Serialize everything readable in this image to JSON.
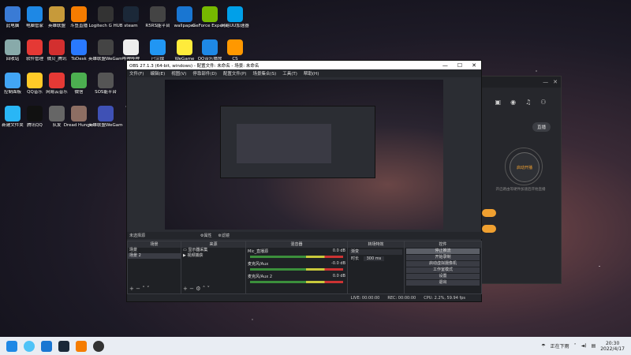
{
  "desktop_icons": [
    {
      "label": "此电脑",
      "color": "#3a7bd5"
    },
    {
      "label": "电脑管家",
      "color": "#1e88e5"
    },
    {
      "label": "英雄联盟",
      "color": "#c79a3a"
    },
    {
      "label": "斗鱼直播",
      "color": "#f57c00"
    },
    {
      "label": "Logitech G HUB",
      "color": "#333"
    },
    {
      "label": "steam",
      "color": "#1b2838"
    },
    {
      "label": "R5RS能平台",
      "color": "#444"
    },
    {
      "label": "wallpaper",
      "color": "#1976d2"
    },
    {
      "label": "GeForce Experience",
      "color": "#76b900"
    },
    {
      "label": "网易UU加速器",
      "color": "#00a0e9"
    },
    {
      "label": "回收站",
      "color": "#8aa"
    },
    {
      "label": "软件管理",
      "color": "#e53935"
    },
    {
      "label": "微贝_腾讯",
      "color": "#d32f2f"
    },
    {
      "label": "ToDesk",
      "color": "#2979ff"
    },
    {
      "label": "英雄联盟WeGame版",
      "color": "#444"
    },
    {
      "label": "哔哩哔哩",
      "color": "#eee"
    },
    {
      "label": "已完成",
      "color": "#2196f3"
    },
    {
      "label": "WeGame",
      "color": "#ffeb3b"
    },
    {
      "label": "QQ音乐播放",
      "color": "#1e88e5"
    },
    {
      "label": "CS",
      "color": "#ff9800"
    },
    {
      "label": "控制面板",
      "color": "#42a5f5"
    },
    {
      "label": "QQ音乐",
      "color": "#ffca28"
    },
    {
      "label": "网易云音乐",
      "color": "#e53935"
    },
    {
      "label": "微信",
      "color": "#4caf50"
    },
    {
      "label": "SOS能平台",
      "color": "#555"
    },
    {
      "label": "新建文件夹",
      "color": "#29b6f6"
    },
    {
      "label": "腾讯QQ",
      "color": "#111"
    },
    {
      "label": "队友",
      "color": "#666"
    },
    {
      "label": "Dread Hunger",
      "color": "#8d6e63"
    },
    {
      "label": "英雄联盟WeGame版",
      "color": "#3f51b5"
    }
  ],
  "obs": {
    "title": "OBS 27.1.3 (64-bit, windows) - 配置文件: 未命名 - 场景: 未命名",
    "window_controls": [
      "—",
      "☐",
      "✕"
    ],
    "menu": [
      "文件(F)",
      "编辑(E)",
      "视图(V)",
      "停靠部件(D)",
      "配置文件(P)",
      "场景集合(S)",
      "工具(T)",
      "帮助(H)"
    ],
    "scene_label": "未选择源",
    "properties_label": "⚙属性",
    "filters_label": "⚙滤镜",
    "docks": {
      "scenes": {
        "title": "场景",
        "items": [
          "场景",
          "场景 2"
        ]
      },
      "sources": {
        "title": "来源",
        "items": [
          "显示器采集",
          "视频捕获"
        ]
      },
      "mixer": {
        "title": "混音器",
        "channels": [
          {
            "name": "Mic_直播源",
            "value": "0.0 dB"
          },
          {
            "name": "麦克风/Aux",
            "value": "-0.0 dB"
          },
          {
            "name": "麦克风/Aux 2",
            "value": "0.0 dB"
          }
        ]
      },
      "transitions": {
        "title": "转场特效",
        "type": "渐变",
        "duration_label": "时长",
        "duration_value": "300 ms"
      },
      "controls": {
        "title": "控件",
        "buttons": [
          "停止推流",
          "开始录制",
          "启动虚拟摄像机",
          "工作室模式",
          "设置",
          "退出"
        ]
      }
    },
    "status": {
      "live": "LIVE: 00:00:00",
      "rec": "REC: 00:00:00",
      "cpu": "CPU: 2.2%, 59.94 fps"
    }
  },
  "right_app": {
    "top_button": "直播",
    "center_button": "启动开播",
    "hint": "开启路由等硬件加速后开始直播"
  },
  "taskbar": {
    "weather": "正在下雨",
    "time": "20:30",
    "date": "2022/4/17"
  }
}
